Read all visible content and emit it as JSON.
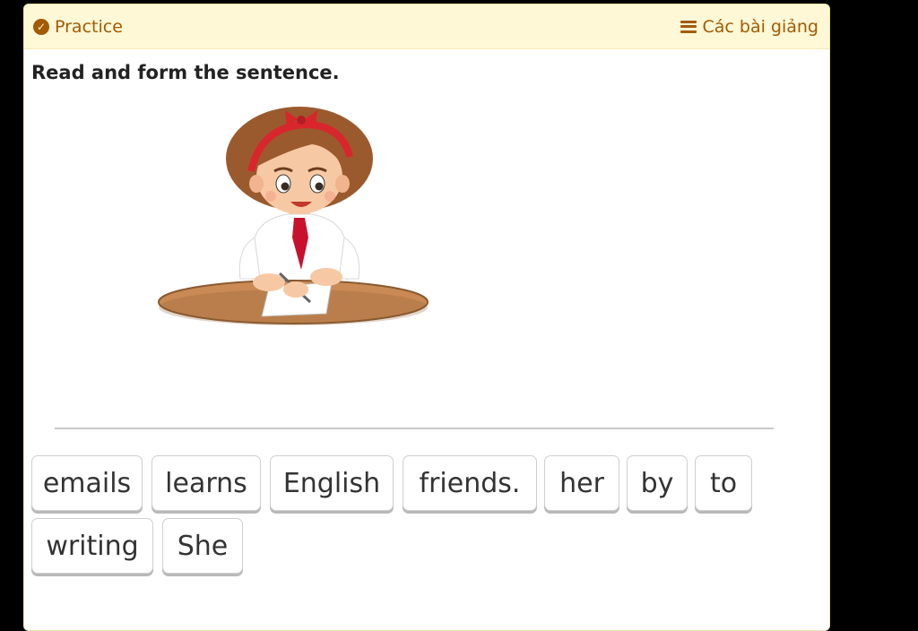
{
  "header": {
    "practice_label": "Practice",
    "lessons_label": "Các bài giảng"
  },
  "instruction": "Read and form the sentence.",
  "illustration": {
    "subject": "girl writing at a desk",
    "colors": {
      "hair": "#9b5a2e",
      "ribbon": "#d8262c",
      "shirt": "#ffffff",
      "tie": "#c8102e",
      "table": "#c98a55",
      "paper": "#ffffff"
    }
  },
  "word_bank": [
    "emails",
    "learns",
    "English",
    "friends.",
    "her",
    "by",
    "to",
    "writing",
    "She"
  ],
  "colors": {
    "accent": "#a35a00",
    "header_bg": "#fff8d6"
  }
}
